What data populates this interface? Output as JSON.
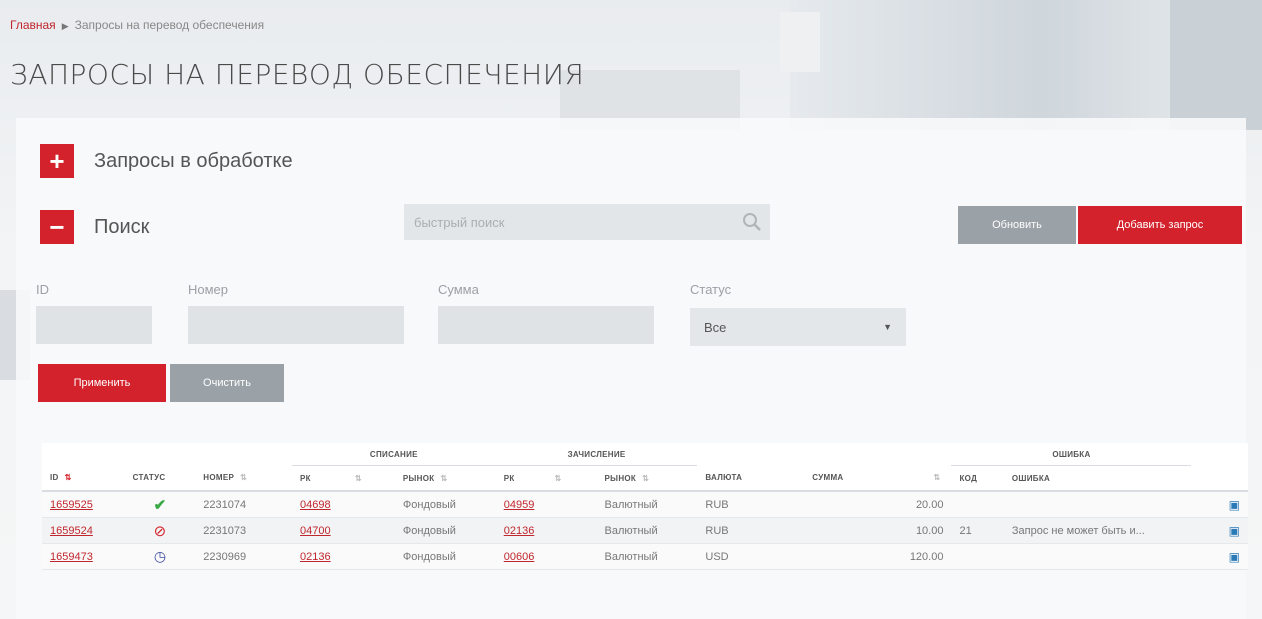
{
  "breadcrumb": {
    "home": "Главная",
    "current": "Запросы на перевод обеспечения"
  },
  "page_title": "ЗАПРОСЫ НА ПЕРЕВОД ОБЕСПЕЧЕНИЯ",
  "sections": {
    "in_progress": "Запросы в обработке",
    "search": "Поиск"
  },
  "quick_search": {
    "placeholder": "быстрый поиск"
  },
  "buttons": {
    "refresh": "Обновить",
    "add_request": "Добавить запрос",
    "apply": "Применить",
    "clear": "Очистить"
  },
  "filters": {
    "id_label": "ID",
    "number_label": "Номер",
    "sum_label": "Сумма",
    "status_label": "Статус",
    "status_value": "Все"
  },
  "table": {
    "groups": {
      "debit": "СПИСАНИЕ",
      "credit": "ЗАЧИСЛЕНИЕ",
      "error": "ОШИБКА"
    },
    "columns": {
      "id": "ID",
      "status": "СТАТУС",
      "number": "НОМЕР",
      "rk1": "РК",
      "market1": "РЫНОК",
      "rk2": "РК",
      "market2": "РЫНОК",
      "currency": "ВАЛЮТА",
      "amount": "СУММА",
      "code": "КОД",
      "error": "ОШИБКА"
    },
    "rows": [
      {
        "id": "1659525",
        "status": "success",
        "number": "2231074",
        "rk1": "04698",
        "market1": "Фондовый",
        "rk2": "04959",
        "market2": "Валютный",
        "currency": "RUB",
        "amount": "20.00",
        "code": "",
        "error": ""
      },
      {
        "id": "1659524",
        "status": "error",
        "number": "2231073",
        "rk1": "04700",
        "market1": "Фондовый",
        "rk2": "02136",
        "market2": "Валютный",
        "currency": "RUB",
        "amount": "10.00",
        "code": "21",
        "error": "Запрос не может быть и..."
      },
      {
        "id": "1659473",
        "status": "pending",
        "number": "2230969",
        "rk1": "02136",
        "market1": "Фондовый",
        "rk2": "00606",
        "market2": "Валютный",
        "currency": "USD",
        "amount": "120.00",
        "code": "",
        "error": ""
      }
    ]
  },
  "colors": {
    "accent": "#d3222c",
    "gray_button": "#9aa1a7",
    "link": "#c0262d"
  }
}
